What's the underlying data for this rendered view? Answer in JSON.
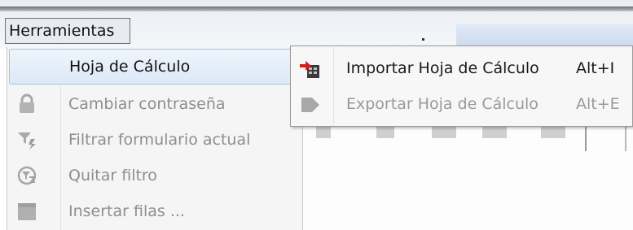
{
  "menubar": {
    "title": "Herramientas"
  },
  "dropdown": {
    "items": [
      {
        "label": "Hoja de Cálculo",
        "icon": "none",
        "state": "active",
        "has_submenu": true
      },
      {
        "label": "Cambiar contraseña",
        "icon": "lock-icon",
        "state": "disabled"
      },
      {
        "label": "Filtrar formulario actual",
        "icon": "filter-icon",
        "state": "disabled"
      },
      {
        "label": "Quitar filtro",
        "icon": "remove-filter-icon",
        "state": "disabled"
      },
      {
        "label": "Insertar filas ...",
        "icon": "insert-rows-icon",
        "state": "disabled"
      }
    ]
  },
  "submenu": {
    "items": [
      {
        "label": "Importar Hoja de Cálculo",
        "shortcut": "Alt+I",
        "icon": "import-spreadsheet-icon",
        "state": "enabled"
      },
      {
        "label": "Exportar Hoja de Cálculo",
        "shortcut": "Alt+E",
        "icon": "export-spreadsheet-icon",
        "state": "disabled"
      }
    ]
  },
  "colors": {
    "highlight": "#dde9f8",
    "disabled_text": "#8e8e8e",
    "import_arrow": "#d81b1b"
  }
}
